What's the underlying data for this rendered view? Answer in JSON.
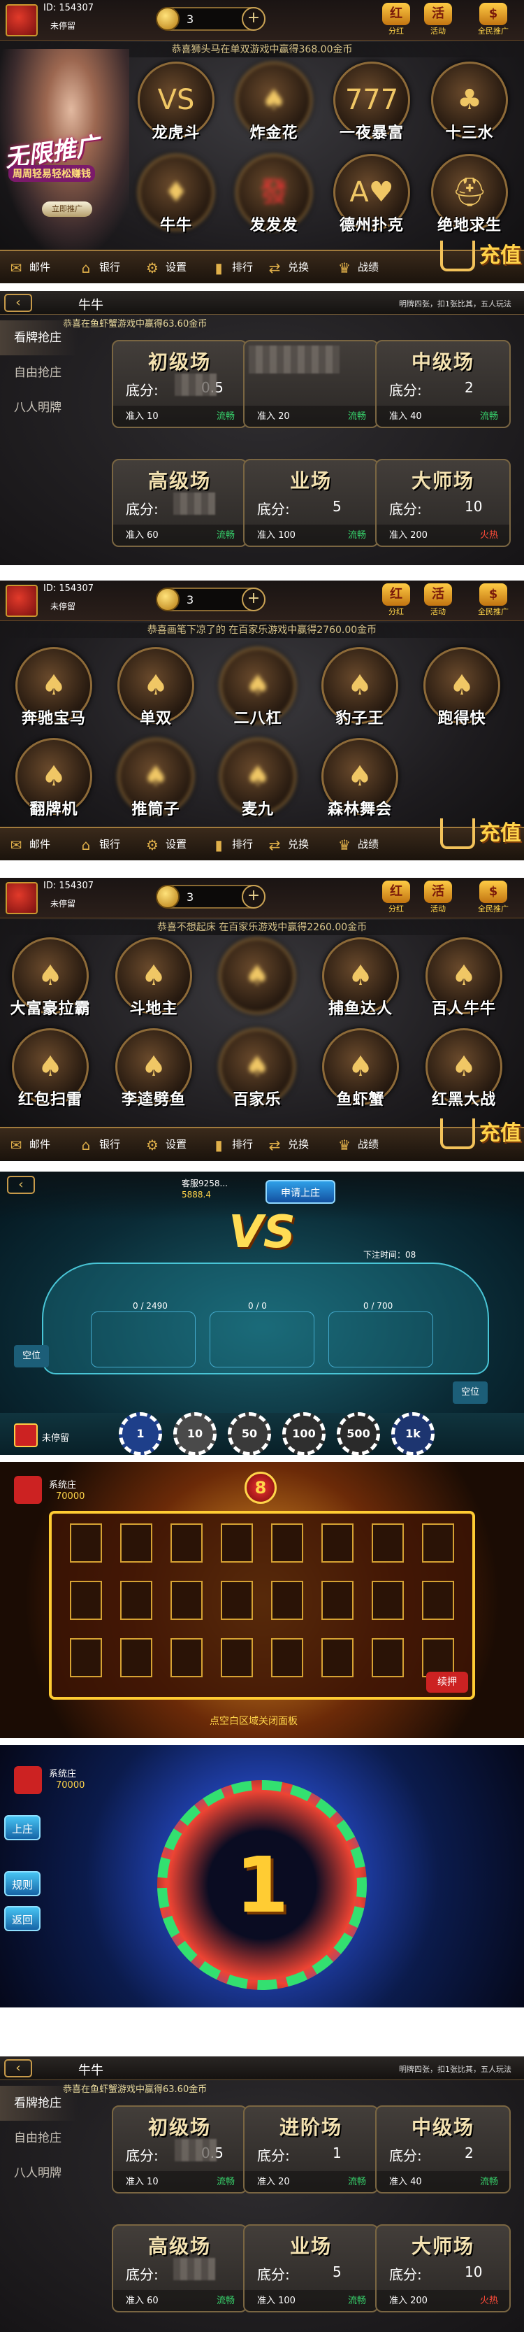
{
  "lobby1": {
    "id": "ID: 154307",
    "name": "未停留",
    "coins": "3",
    "ticker": "恭喜狮头马在单双游戏中赢得368.00金币",
    "top_icons": [
      "分红",
      "活动",
      "全民推广"
    ],
    "slogan": "无限推广",
    "slogan2": "周周轻易轻松赚钱",
    "slogan_btn": "立即推广",
    "games": [
      "龙虎斗",
      "炸金花",
      "一夜暴富",
      "十三水",
      "牛牛",
      "发发发",
      "德州扑克",
      "绝地求生"
    ]
  },
  "bottombar": {
    "items": [
      "邮件",
      "银行",
      "设置",
      "排行",
      "兑换",
      "战绩"
    ],
    "recharge": "充值"
  },
  "room1": {
    "title": "牛牛",
    "rules": "明牌四张，扣1张比其，五人玩法",
    "ticker": "恭喜在鱼虾蟹游戏中赢得63.60金币",
    "side": [
      "看牌抢庄",
      "自由抢庄",
      "八人明牌"
    ],
    "cards": [
      {
        "title": "初级场",
        "base_label": "底分:",
        "base": "0.5",
        "enter": "准入 10",
        "status": "流畅"
      },
      {
        "title": "",
        "base_label": "",
        "base": "",
        "enter": "准入 20",
        "status": "流畅"
      },
      {
        "title": "中级场",
        "base_label": "底分:",
        "base": "2",
        "enter": "准入 40",
        "status": "流畅"
      },
      {
        "title": "高级场",
        "base_label": "底分:",
        "base": "",
        "enter": "准入 60",
        "status": "流畅"
      },
      {
        "title": "业场",
        "base_label": "底分:",
        "base": "5",
        "enter": "准入 100",
        "status": "流畅"
      },
      {
        "title": "大师场",
        "base_label": "底分:",
        "base": "10",
        "enter": "准入 200",
        "status": "火热"
      }
    ]
  },
  "lobby2": {
    "ticker": "恭喜画笔下凉了的 在百家乐游戏中赢得2760.00金币",
    "games": [
      "奔驰宝马",
      "单双",
      "二八杠",
      "豹子王",
      "跑得快",
      "翻牌机",
      "推筒子",
      "麦九",
      "森林舞会"
    ]
  },
  "lobby3": {
    "ticker": "恭喜不想起床 在百家乐游戏中赢得2260.00金币",
    "games": [
      "大富豪拉霸",
      "斗地主",
      "",
      "捕鱼达人",
      "百人牛牛",
      "红包扫雷",
      "李逵劈鱼",
      "百家乐",
      "鱼虾蟹",
      "红黑大战"
    ]
  },
  "table": {
    "banker": "申请上庄",
    "money": "客服9258...",
    "money2": "5888.4",
    "timer": "下注时间：08",
    "seat": "空位",
    "bet_left": "0 / 2490",
    "bet_mid": "0 / 0",
    "bet_right": "0 / 700",
    "player": "未停留",
    "chips": [
      "1",
      "10",
      "50",
      "100",
      "500",
      "1k"
    ]
  },
  "slot": {
    "system": "系统庄",
    "coins": "70000",
    "count": "8",
    "footer": "点空白区域关闭面板",
    "btn": "续押"
  },
  "wheel": {
    "system": "系统庄",
    "coins": "70000",
    "center": "1",
    "buttons": [
      "上庄",
      "规则",
      "返回"
    ]
  },
  "room2": {
    "title": "牛牛",
    "rules": "明牌四张，扣1张比其，五人玩法",
    "ticker": "恭喜在鱼虾蟹游戏中赢得63.60金币",
    "side": [
      "看牌抢庄",
      "自由抢庄",
      "八人明牌"
    ],
    "cards": [
      {
        "title": "初级场",
        "base_label": "底分:",
        "base": "0.5",
        "enter": "准入 10",
        "status": "流畅"
      },
      {
        "title": "进阶场",
        "base_label": "底分:",
        "base": "1",
        "enter": "准入 20",
        "status": "流畅"
      },
      {
        "title": "中级场",
        "base_label": "底分:",
        "base": "2",
        "enter": "准入 40",
        "status": "流畅"
      },
      {
        "title": "高级场",
        "base_label": "底分:",
        "base": "",
        "enter": "准入 60",
        "status": "流畅"
      },
      {
        "title": "业场",
        "base_label": "底分:",
        "base": "5",
        "enter": "准入 100",
        "status": "流畅"
      },
      {
        "title": "大师场",
        "base_label": "底分:",
        "base": "10",
        "enter": "准入 200",
        "status": "火热"
      }
    ]
  },
  "colors": {
    "gold": "#f0c765",
    "green_status": "#37d16b",
    "red_status": "#ff4b3a"
  }
}
